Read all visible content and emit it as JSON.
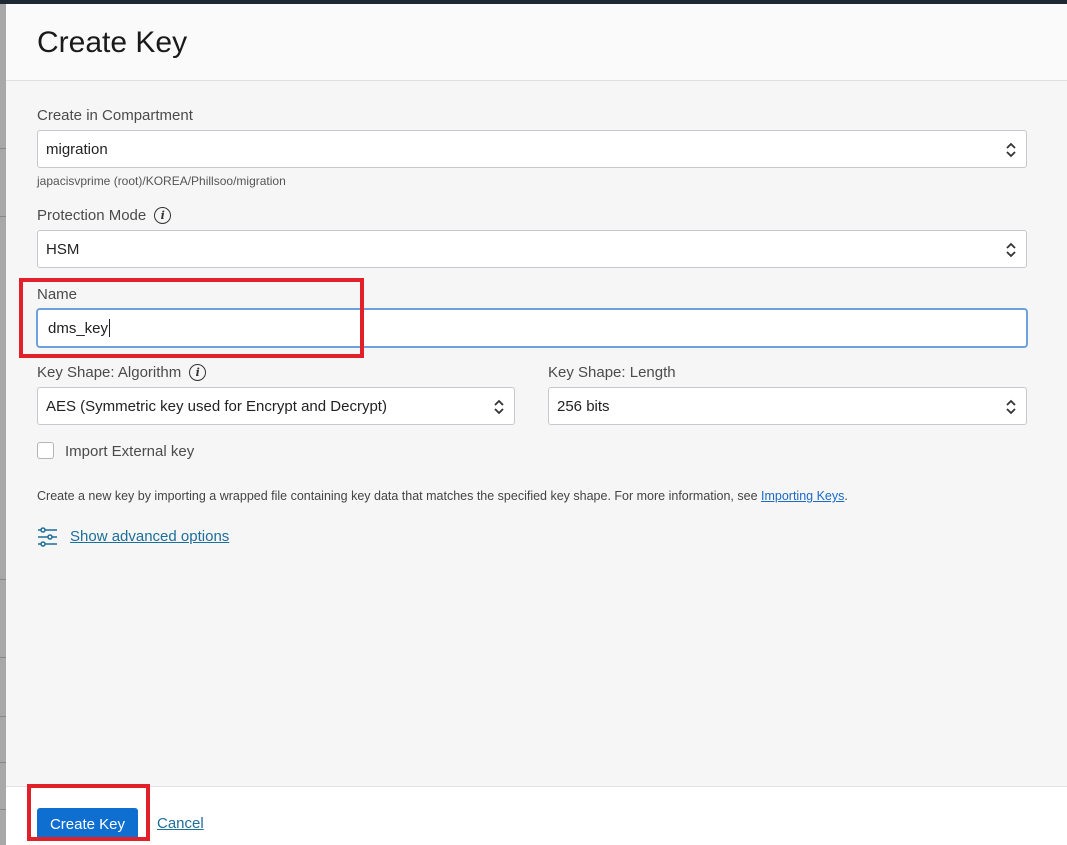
{
  "dialog": {
    "title": "Create Key"
  },
  "form": {
    "compartment": {
      "label": "Create in Compartment",
      "value": "migration",
      "path_hint": "japacisvprime (root)/KOREA/Phillsoo/migration"
    },
    "protection_mode": {
      "label": "Protection Mode",
      "value": "HSM",
      "info_icon": "info-icon"
    },
    "name": {
      "label": "Name",
      "value": "dms_key"
    },
    "algorithm": {
      "label": "Key Shape: Algorithm",
      "value": "AES (Symmetric key used for Encrypt and Decrypt)",
      "info_icon": "info-icon"
    },
    "length": {
      "label": "Key Shape: Length",
      "value": "256 bits"
    },
    "import_external": {
      "label": "Import External key",
      "checked": false
    },
    "description": {
      "text": "Create a new key by importing a wrapped file containing key data that matches the specified key shape. For more information, see ",
      "link": "Importing Keys",
      "suffix": "."
    },
    "advanced": {
      "label": "Show advanced options",
      "icon": "sliders-icon"
    }
  },
  "footer": {
    "create_label": "Create Key",
    "cancel_label": "Cancel"
  },
  "colors": {
    "primary": "#0f6fd1",
    "link": "#1d6e99",
    "highlight": "#e2202a",
    "focus": "#6f9fdc"
  }
}
